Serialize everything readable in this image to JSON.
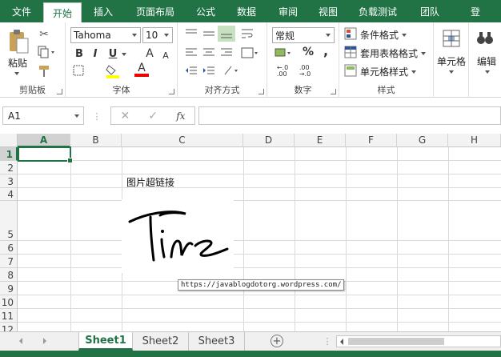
{
  "tabs": [
    "文件",
    "开始",
    "插入",
    "页面布局",
    "公式",
    "数据",
    "审阅",
    "视图",
    "负载测试",
    "团队",
    "登"
  ],
  "ribbon": {
    "clipboard": {
      "title": "剪贴板",
      "paste": "粘贴"
    },
    "font": {
      "title": "字体",
      "name": "Tahoma",
      "size": "10",
      "bold": "B",
      "italic": "I",
      "underline": "U",
      "grow": "A",
      "shrink": "A",
      "font_color": "A"
    },
    "alignment": {
      "title": "对齐方式"
    },
    "number": {
      "title": "数字",
      "format": "常规",
      "percent": "%",
      "comma": ","
    },
    "styles": {
      "title": "样式",
      "conditional": "条件格式",
      "table": "套用表格格式",
      "cell": "单元格样式"
    },
    "cells": {
      "label": "单元格"
    },
    "editing": {
      "label": "编辑"
    }
  },
  "formula_bar": {
    "name_box": "A1",
    "fx": "fx",
    "value": ""
  },
  "columns": [
    "A",
    "B",
    "C",
    "D",
    "E",
    "F",
    "G",
    "H"
  ],
  "rows": [
    "1",
    "2",
    "3",
    "4",
    "5",
    "6",
    "7",
    "8",
    "9",
    "10",
    "11",
    "12"
  ],
  "cells": {
    "C3": "图片超链接"
  },
  "picture": {
    "signature_text": "Tina"
  },
  "tooltip": "https://javablogdotorg.wordpress.com/",
  "sheets": [
    "Sheet1",
    "Sheet2",
    "Sheet3"
  ],
  "colors": {
    "brand": "#217346",
    "selection": "#217346"
  }
}
